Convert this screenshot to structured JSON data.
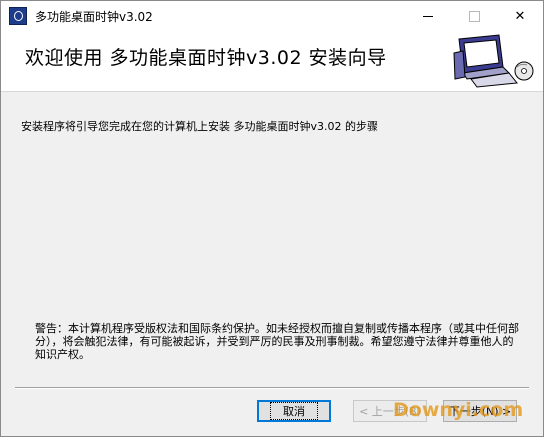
{
  "window": {
    "title": "多功能桌面时钟v3.02",
    "icon": "installer-app-icon",
    "controls": {
      "minimize": "minimize-icon",
      "maximize": "maximize-icon",
      "close": "✕"
    }
  },
  "header": {
    "title": "欢迎使用  多功能桌面时钟v3.02  安装向导",
    "graphic": "computer-setup-icon"
  },
  "main": {
    "intro": "安装程序将引导您完成在您的计算机上安装 多功能桌面时钟v3.02 的步骤",
    "warning": "警告：本计算机程序受版权法和国际条约保护。如未经授权而擅自复制或传播本程序（或其中任何部分），将会触犯法律，有可能被起诉，并受到严厉的民事及刑事制裁。希望您遵守法律并尊重他人的知识产权。"
  },
  "buttons": {
    "cancel": "取消",
    "back": "< 上一步(B)",
    "next": "下一步(N) >"
  },
  "watermark": "Downyi.com",
  "colors": {
    "accent": "#0078d7",
    "background": "#f0f0f0",
    "header_bg": "#ffffff"
  }
}
